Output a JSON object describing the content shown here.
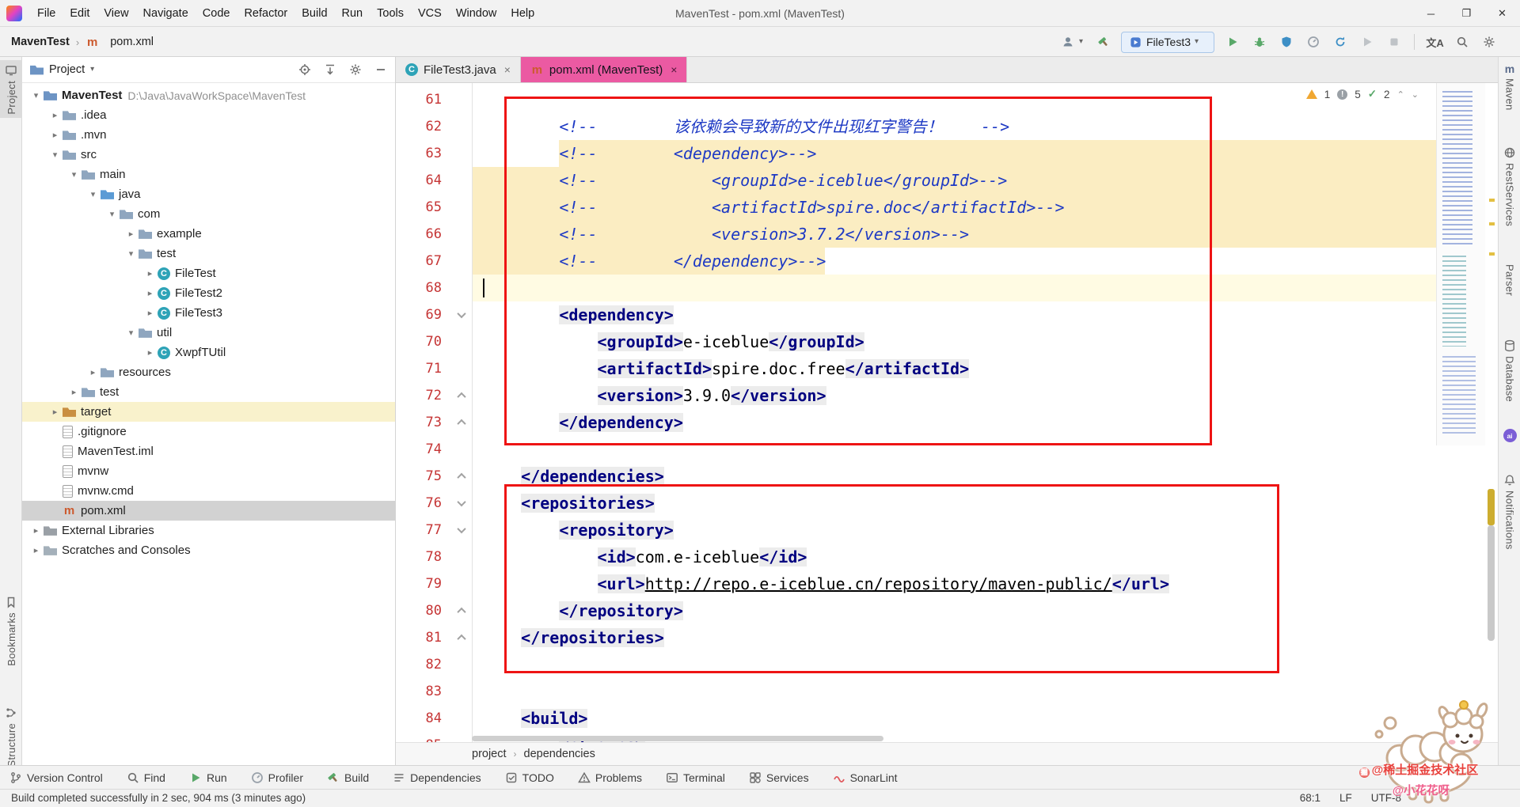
{
  "colors": {
    "tab-pink": "#eb5aa2",
    "annotation-red": "#ee1414",
    "selection-beige": "#fbedc2",
    "caret-line-yellow": "#fffbe3",
    "tag-navy": "#000080",
    "comment-blue": "#1d39c4",
    "line-number-red": "#c53434",
    "tag-bg": "#ececec",
    "tree-selection": "#d2d2d2",
    "target-row-yellow": "#f9f2cc",
    "run-green": "#59a869",
    "warning-yellow": "#f0a732",
    "maven-orange": "#cc5a2e"
  },
  "title_bar": {
    "menus": [
      "File",
      "Edit",
      "View",
      "Navigate",
      "Code",
      "Refactor",
      "Build",
      "Run",
      "Tools",
      "VCS",
      "Window",
      "Help"
    ],
    "title": "MavenTest - pom.xml (MavenTest)",
    "minimize": "─",
    "maximize": "❐",
    "close": "✕"
  },
  "nav_bar": {
    "project": "MavenTest",
    "file": "pom.xml",
    "run_config": "FileTest3",
    "actions": [
      {
        "icon": "person",
        "caret": true
      },
      {
        "icon": "hammer"
      },
      {
        "combo": true,
        "icon": "app",
        "label": "FileTest3",
        "caret": true
      },
      {
        "icon": "play"
      },
      {
        "icon": "debug"
      },
      {
        "icon": "coverage"
      },
      {
        "icon": "profiler"
      },
      {
        "icon": "rerun"
      },
      {
        "icon": "play-disabled"
      },
      {
        "icon": "stop-disabled"
      },
      {
        "sep": true
      },
      {
        "icon": "translate"
      },
      {
        "icon": "search"
      },
      {
        "icon": "gear"
      }
    ]
  },
  "left_stripe": {
    "items": [
      "Project",
      "Bookmarks",
      "Structure"
    ]
  },
  "right_stripe": {
    "items": [
      "Maven",
      "RestServices",
      "Parser",
      "Database",
      "Notifications"
    ]
  },
  "project_panel": {
    "header": "Project",
    "tree": [
      {
        "label": "MavenTest",
        "hint": "D:\\Java\\JavaWorkSpace\\MavenTest",
        "indent": 0,
        "chevron": "down",
        "icon": "project",
        "bold": true
      },
      {
        "label": ".idea",
        "indent": 1,
        "chevron": "right",
        "icon": "folder"
      },
      {
        "label": ".mvn",
        "indent": 1,
        "chevron": "right",
        "icon": "folder"
      },
      {
        "label": "src",
        "indent": 1,
        "chevron": "down",
        "icon": "folder"
      },
      {
        "label": "main",
        "indent": 2,
        "chevron": "down",
        "icon": "folder"
      },
      {
        "label": "java",
        "indent": 3,
        "chevron": "down",
        "icon": "src"
      },
      {
        "label": "com",
        "indent": 4,
        "chevron": "down",
        "icon": "package"
      },
      {
        "label": "example",
        "indent": 5,
        "chevron": "right",
        "icon": "package"
      },
      {
        "label": "test",
        "indent": 5,
        "chevron": "down",
        "icon": "package"
      },
      {
        "label": "FileTest",
        "indent": 6,
        "chevron": "right",
        "icon": "class"
      },
      {
        "label": "FileTest2",
        "indent": 6,
        "chevron": "right",
        "icon": "class"
      },
      {
        "label": "FileTest3",
        "indent": 6,
        "chevron": "right",
        "icon": "class"
      },
      {
        "label": "util",
        "indent": 5,
        "chevron": "down",
        "icon": "package"
      },
      {
        "label": "XwpfTUtil",
        "indent": 6,
        "chevron": "right",
        "icon": "class"
      },
      {
        "label": "resources",
        "indent": 3,
        "chevron": "right",
        "icon": "folder"
      },
      {
        "label": "test",
        "indent": 2,
        "chevron": "right",
        "icon": "folder"
      },
      {
        "label": "target",
        "indent": 1,
        "chevron": "right",
        "icon": "excluded",
        "highlight": true
      },
      {
        "label": ".gitignore",
        "indent": 1,
        "icon": "file"
      },
      {
        "label": "MavenTest.iml",
        "indent": 1,
        "icon": "file"
      },
      {
        "label": "mvnw",
        "indent": 1,
        "icon": "file"
      },
      {
        "label": "mvnw.cmd",
        "indent": 1,
        "icon": "file"
      },
      {
        "label": "pom.xml",
        "indent": 1,
        "icon": "maven",
        "selected": true
      },
      {
        "label": "External Libraries",
        "indent": 0,
        "chevron": "right",
        "icon": "lib"
      },
      {
        "label": "Scratches and Consoles",
        "indent": 0,
        "chevron": "right",
        "icon": "scratch"
      }
    ]
  },
  "editor": {
    "tabs": [
      {
        "label": "FileTest3.java",
        "icon": "class",
        "close": "×"
      },
      {
        "label": "pom.xml (MavenTest)",
        "icon": "maven",
        "active": true,
        "close": "×"
      }
    ],
    "inspections": {
      "warnings": "1",
      "weak": "5",
      "ok": "2"
    },
    "breadcrumbs": [
      "project",
      "dependencies"
    ],
    "lines": [
      {
        "n": 61,
        "tokens": []
      },
      {
        "n": 62,
        "tokens": [
          {
            "t": "plain",
            "s": "        "
          },
          {
            "t": "comment",
            "s": "<!--        该依赖会导致新的文件出现红字警告！    -->"
          }
        ]
      },
      {
        "n": 63,
        "sel": "tail",
        "selCol": 8,
        "tokens": [
          {
            "t": "plain",
            "s": "        "
          },
          {
            "t": "comment",
            "s": "<!--        <dependency>-->"
          }
        ]
      },
      {
        "n": 64,
        "sel": "full",
        "tokens": [
          {
            "t": "plain",
            "s": "        "
          },
          {
            "t": "comment",
            "s": "<!--            <groupId>e-iceblue</groupId>-->"
          }
        ]
      },
      {
        "n": 65,
        "sel": "full",
        "tokens": [
          {
            "t": "plain",
            "s": "        "
          },
          {
            "t": "comment",
            "s": "<!--            <artifactId>spire.doc</artifactId>-->"
          }
        ]
      },
      {
        "n": 66,
        "sel": "full",
        "tokens": [
          {
            "t": "plain",
            "s": "        "
          },
          {
            "t": "comment",
            "s": "<!--            <version>3.7.2</version>-->"
          }
        ]
      },
      {
        "n": 67,
        "sel": "head",
        "selCol": 36,
        "tokens": [
          {
            "t": "plain",
            "s": "        "
          },
          {
            "t": "comment",
            "s": "<!--        </dependency>-->"
          }
        ]
      },
      {
        "n": 68,
        "caret": true,
        "tokens": []
      },
      {
        "n": 69,
        "fold": "open",
        "tokens": [
          {
            "t": "plain",
            "s": "        "
          },
          {
            "t": "tag",
            "s": "<dependency>"
          }
        ]
      },
      {
        "n": 70,
        "tokens": [
          {
            "t": "plain",
            "s": "            "
          },
          {
            "t": "tag",
            "s": "<groupId>"
          },
          {
            "t": "text",
            "s": "e-iceblue"
          },
          {
            "t": "tag",
            "s": "</groupId>"
          }
        ]
      },
      {
        "n": 71,
        "tokens": [
          {
            "t": "plain",
            "s": "            "
          },
          {
            "t": "tag",
            "s": "<artifactId>"
          },
          {
            "t": "text",
            "s": "spire.doc.free"
          },
          {
            "t": "tag",
            "s": "</artifactId>"
          }
        ]
      },
      {
        "n": 72,
        "fold": "end",
        "tokens": [
          {
            "t": "plain",
            "s": "            "
          },
          {
            "t": "tag",
            "s": "<version>"
          },
          {
            "t": "text",
            "s": "3.9.0"
          },
          {
            "t": "tag",
            "s": "</version>"
          }
        ]
      },
      {
        "n": 73,
        "fold": "end",
        "tokens": [
          {
            "t": "plain",
            "s": "        "
          },
          {
            "t": "tag",
            "s": "</dependency>"
          }
        ]
      },
      {
        "n": 74,
        "tokens": []
      },
      {
        "n": 75,
        "fold": "end",
        "tokens": [
          {
            "t": "plain",
            "s": "    "
          },
          {
            "t": "tag",
            "s": "</dependencies>"
          }
        ]
      },
      {
        "n": 76,
        "fold": "open",
        "tokens": [
          {
            "t": "plain",
            "s": "    "
          },
          {
            "t": "tag",
            "s": "<repositories>"
          }
        ]
      },
      {
        "n": 77,
        "fold": "open",
        "tokens": [
          {
            "t": "plain",
            "s": "        "
          },
          {
            "t": "tag",
            "s": "<repository>"
          }
        ]
      },
      {
        "n": 78,
        "tokens": [
          {
            "t": "plain",
            "s": "            "
          },
          {
            "t": "tag",
            "s": "<id>"
          },
          {
            "t": "text",
            "s": "com.e-iceblue"
          },
          {
            "t": "tag",
            "s": "</id>"
          }
        ]
      },
      {
        "n": 79,
        "tokens": [
          {
            "t": "plain",
            "s": "            "
          },
          {
            "t": "tag",
            "s": "<url>"
          },
          {
            "t": "link",
            "s": "http://repo.e-iceblue.cn/repository/maven-public/"
          },
          {
            "t": "tag",
            "s": "</url>"
          }
        ]
      },
      {
        "n": 80,
        "fold": "end",
        "tokens": [
          {
            "t": "plain",
            "s": "        "
          },
          {
            "t": "tag",
            "s": "</repository>"
          }
        ]
      },
      {
        "n": 81,
        "fold": "end",
        "tokens": [
          {
            "t": "plain",
            "s": "    "
          },
          {
            "t": "tag",
            "s": "</repositories>"
          }
        ]
      },
      {
        "n": 82,
        "tokens": []
      },
      {
        "n": 83,
        "tokens": []
      },
      {
        "n": 84,
        "tokens": [
          {
            "t": "plain",
            "s": "    "
          },
          {
            "t": "tag",
            "s": "<build>"
          }
        ]
      },
      {
        "n": 85,
        "fold": "open",
        "tokens": [
          {
            "t": "plain",
            "s": "        "
          },
          {
            "t": "tag",
            "s": "<plugins>"
          }
        ]
      }
    ]
  },
  "bottom_bar": {
    "items": [
      {
        "icon": "branch",
        "label": "Version Control"
      },
      {
        "icon": "search",
        "label": "Find"
      },
      {
        "icon": "play",
        "label": "Run"
      },
      {
        "icon": "profiler",
        "label": "Profiler"
      },
      {
        "icon": "hammer",
        "label": "Build"
      },
      {
        "icon": "deps",
        "label": "Dependencies"
      },
      {
        "icon": "todo",
        "label": "TODO"
      },
      {
        "icon": "problems",
        "label": "Problems"
      },
      {
        "icon": "terminal",
        "label": "Terminal"
      },
      {
        "icon": "services",
        "label": "Services"
      },
      {
        "icon": "sonarlint",
        "label": "SonarLint"
      }
    ]
  },
  "status_bar": {
    "message": "Build completed successfully in 2 sec, 904 ms (3 minutes ago)",
    "caret_position": "68:1",
    "line_ending": "LF",
    "encoding": "UTF-8"
  },
  "watermark": {
    "line1": "@稀土掘金技术社区",
    "line2": "@小花花呀"
  }
}
